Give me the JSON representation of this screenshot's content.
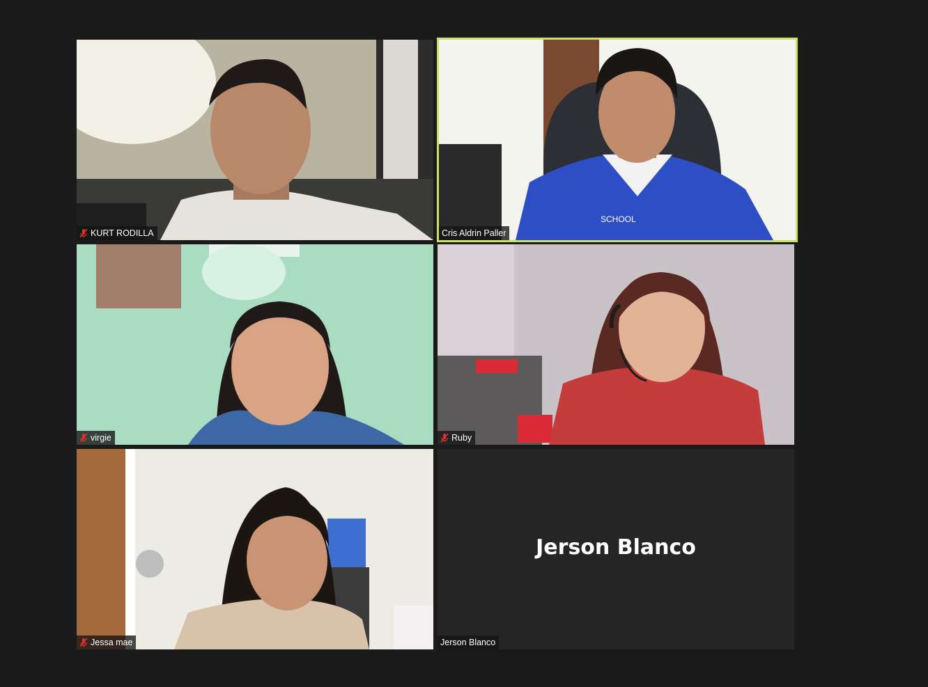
{
  "participants": [
    {
      "name": "KURT RODILLA",
      "muted": true
    },
    {
      "name": "Cris Aldrin Paller",
      "muted": false,
      "active_speaker": true
    },
    {
      "name": "virgie",
      "muted": true
    },
    {
      "name": "Ruby",
      "muted": true
    },
    {
      "name": "Jessa mae",
      "muted": true
    },
    {
      "name": "Jerson Blanco",
      "muted": false,
      "video_off": true
    }
  ],
  "video_off_label": "Jerson Blanco",
  "colors": {
    "background": "#1a1a1a",
    "active_speaker_border": "#c9e266",
    "muted_icon": "#e0302b"
  },
  "icons": {
    "muted": "microphone-muted-icon"
  }
}
